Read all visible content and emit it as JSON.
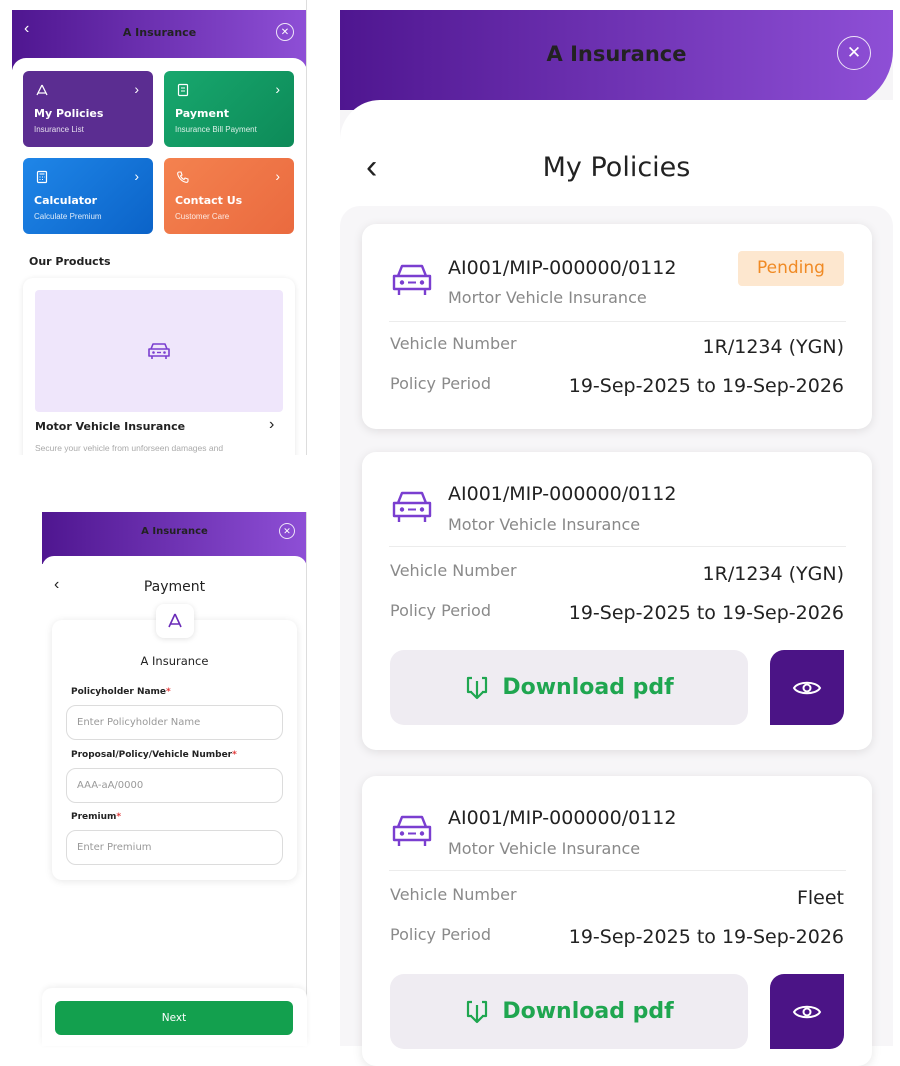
{
  "app_title": "A Insurance",
  "colors": {
    "header_start": "#4f1690",
    "header_end": "#8e4fd6",
    "accent_green": "#1fa650",
    "pending_bg": "#fde7cf",
    "pending_text": "#f08a24"
  },
  "home": {
    "tiles": [
      {
        "title": "My Policies",
        "subtitle": "Insurance List",
        "icon": "policy-icon",
        "color": "#5b2d91"
      },
      {
        "title": "Payment",
        "subtitle": "Insurance Bill Payment",
        "icon": "bill-icon",
        "color": "#109a64"
      },
      {
        "title": "Calculator",
        "subtitle": "Calculate Premium",
        "icon": "calculator-icon",
        "color": "#0b6fd6"
      },
      {
        "title": "Contact Us",
        "subtitle": "Customer Care",
        "icon": "phone-icon",
        "color": "#ee7348"
      }
    ],
    "products_heading": "Our Products",
    "product": {
      "name": "Motor Vehicle Insurance",
      "description": "Secure your vehicle from unforseen damages and"
    }
  },
  "payment": {
    "title": "Payment",
    "company": "A Insurance",
    "fields": [
      {
        "label": "Policyholder Name",
        "required": "*",
        "placeholder": "Enter Policyholder Name"
      },
      {
        "label": "Proposal/Policy/Vehicle Number",
        "required": "*",
        "placeholder": "AAA-aA/0000"
      },
      {
        "label": "Premium",
        "required": "*",
        "placeholder": "Enter Premium"
      }
    ],
    "next_label": "Next"
  },
  "policies": {
    "title": "My Policies",
    "vehicle_label": "Vehicle Number",
    "period_label": "Policy Period",
    "download_label": "Download pdf",
    "items": [
      {
        "number": "AI001/MIP-000000/0112",
        "type": "Mortor Vehicle Insurance",
        "status": "Pending",
        "vehicle": "1R/1234 (YGN)",
        "period": "19-Sep-2025 to 19-Sep-2026"
      },
      {
        "number": "AI001/MIP-000000/0112",
        "type": "Motor Vehicle Insurance",
        "vehicle": "1R/1234 (YGN)",
        "period": "19-Sep-2025 to 19-Sep-2026"
      },
      {
        "number": "AI001/MIP-000000/0112",
        "type": "Motor Vehicle Insurance",
        "vehicle": "Fleet",
        "period": "19-Sep-2025 to 19-Sep-2026"
      }
    ]
  }
}
